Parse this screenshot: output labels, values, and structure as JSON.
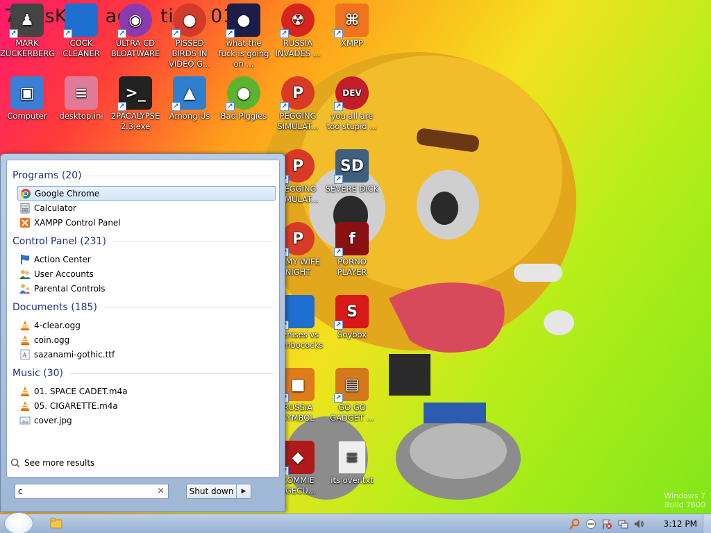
{
  "background": {
    "title_text": "7 ossK      ae     tion  012",
    "watermark_line1": "Windows 7",
    "watermark_line2": "Build 7600"
  },
  "desktop_icons": [
    {
      "label": "MARK ZUCKERBERG",
      "icon": "person-icon",
      "color": "#444444"
    },
    {
      "label": "COCK CLEANER",
      "icon": "blue-box-icon",
      "color": "#1e6fd0"
    },
    {
      "label": "ULTRA CD BLOATWARE",
      "icon": "disc-icon",
      "color": "#8b3bb0"
    },
    {
      "label": "PISSED BIRDS IN VIDEO G...",
      "icon": "angry-bird-icon",
      "color": "#d23a2a"
    },
    {
      "label": "what the fuck is going on ...",
      "icon": "angry-bird-space-icon",
      "color": "#1d1d4a"
    },
    {
      "label": "RUSSIA INVADES ...",
      "icon": "radiation-icon",
      "color": "#d6251c"
    },
    {
      "label": "XMPP",
      "icon": "xampp-icon",
      "color": "#f0731f"
    },
    {
      "label": "Computer",
      "icon": "computer-icon",
      "color": "#3b7ed6"
    },
    {
      "label": "desktop.ini",
      "icon": "ini-file-icon",
      "color": "#e07a98"
    },
    {
      "label": "2PACALYPSE 2.3.exe",
      "icon": "console-icon",
      "color": "#222222"
    },
    {
      "label": "Among Us",
      "icon": "among-us-icon",
      "color": "#2f7fd1"
    },
    {
      "label": "Bad Piggies",
      "icon": "pig-icon",
      "color": "#5bb330"
    },
    {
      "label": "PEGGING SIMULAT...",
      "icon": "p-icon",
      "color": "#d93a26"
    },
    {
      "label": "you all are too stupid ...",
      "icon": "dev-cpp-icon",
      "color": "#c31d2a"
    },
    {
      "label": "PEGGING SIMULAT...",
      "icon": "p-icon",
      "color": "#d93a26"
    },
    {
      "label": "SEVERE DICK",
      "icon": "sd-icon",
      "color": "#3f5f7f"
    },
    {
      "label": "IS MY WIFE NIGHT",
      "icon": "p-icon",
      "color": "#d93a26"
    },
    {
      "label": "PORNO PLAYER",
      "icon": "flash-icon",
      "color": "#8a1111"
    },
    {
      "label": "penises vs dumbococks",
      "icon": "blue-box-icon",
      "color": "#1e6fd0"
    },
    {
      "label": "Soybox",
      "icon": "soybox-icon",
      "color": "#d91818"
    },
    {
      "label": "RUSSIA SYMBOL",
      "icon": "cube-icon",
      "color": "#e07b1b"
    },
    {
      "label": "GO GO GADGET ...",
      "icon": "briefcase-icon",
      "color": "#d4781c"
    },
    {
      "label": "COMMIE AGECU...",
      "icon": "shield-icon",
      "color": "#b11a1a"
    },
    {
      "label": "its over.txt",
      "icon": "text-file-icon",
      "color": "#eeeeee"
    }
  ],
  "start_menu": {
    "groups": [
      {
        "title": "Programs (20)",
        "items": [
          {
            "label": "Google Chrome",
            "icon": "chrome-icon",
            "selected": true
          },
          {
            "label": "Calculator",
            "icon": "calculator-icon"
          },
          {
            "label": "XAMPP Control Panel",
            "icon": "xampp-icon"
          }
        ]
      },
      {
        "title": "Control Panel (231)",
        "items": [
          {
            "label": "Action Center",
            "icon": "flag-icon"
          },
          {
            "label": "User Accounts",
            "icon": "users-icon"
          },
          {
            "label": "Parental Controls",
            "icon": "parental-icon"
          }
        ]
      },
      {
        "title": "Documents (185)",
        "items": [
          {
            "label": "4-clear.ogg",
            "icon": "vlc-icon"
          },
          {
            "label": "coin.ogg",
            "icon": "vlc-icon"
          },
          {
            "label": "sazanami-gothic.ttf",
            "icon": "font-file-icon"
          }
        ]
      },
      {
        "title": "Music (30)",
        "items": [
          {
            "label": "01. SPACE CADET.m4a",
            "icon": "vlc-icon"
          },
          {
            "label": "05. CIGARETTE.m4a",
            "icon": "vlc-icon"
          },
          {
            "label": "cover.jpg",
            "icon": "image-file-icon"
          }
        ]
      }
    ],
    "see_more": "See more results",
    "search_value": "c",
    "search_clear": "×",
    "shutdown_label": "Shut down",
    "shutdown_arrow": "▶"
  },
  "taskbar": {
    "clock": "3:12 PM"
  }
}
